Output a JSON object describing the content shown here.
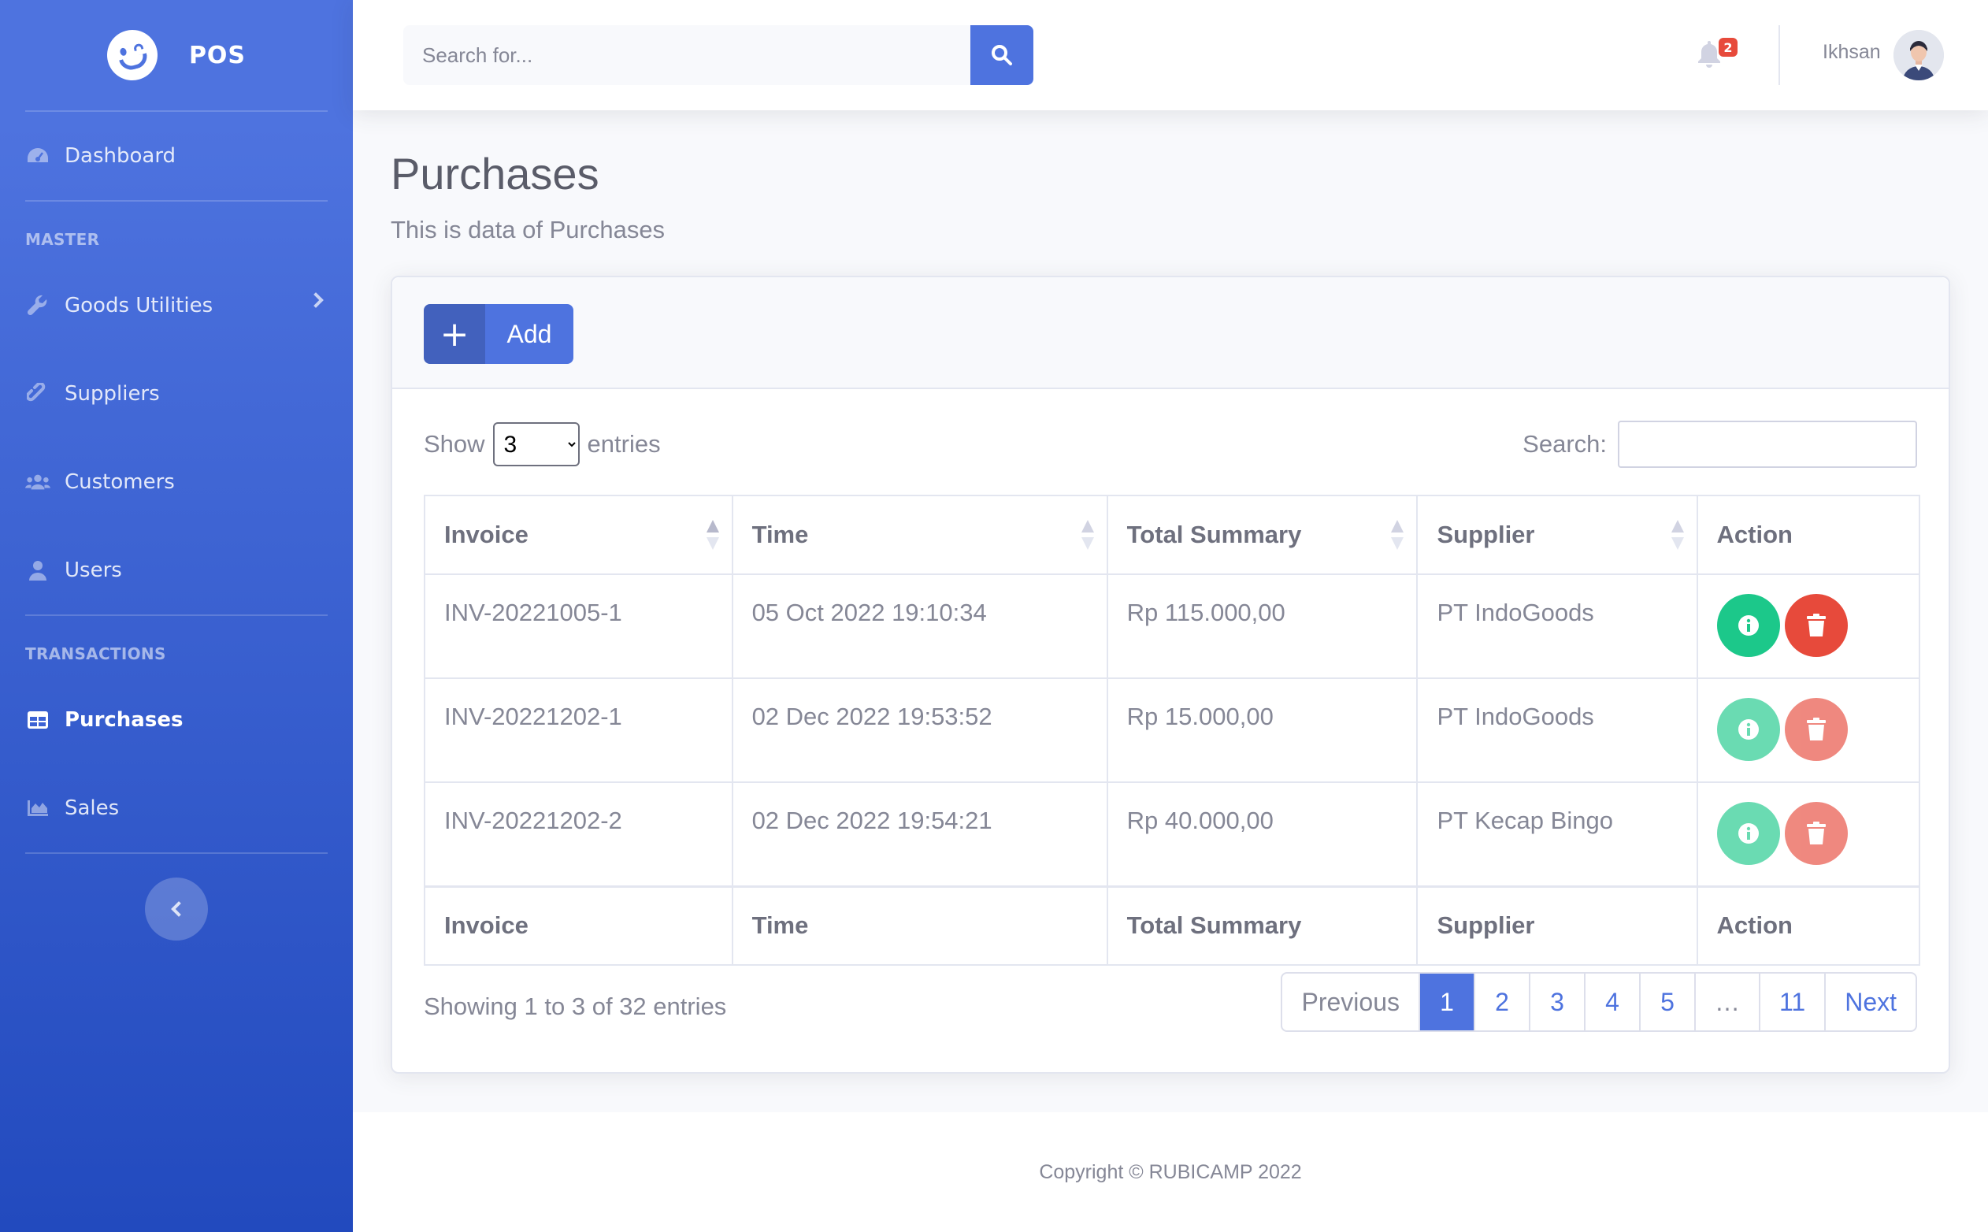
{
  "brand": {
    "name": "POS"
  },
  "sidebar": {
    "dashboard": "Dashboard",
    "heading_master": "MASTER",
    "goods_utilities": "Goods Utilities",
    "suppliers": "Suppliers",
    "customers": "Customers",
    "users": "Users",
    "heading_transactions": "TRANSACTIONS",
    "purchases": "Purchases",
    "sales": "Sales"
  },
  "topbar": {
    "search_placeholder": "Search for...",
    "notification_count": "2",
    "username": "Ikhsan"
  },
  "page": {
    "title": "Purchases",
    "subtitle": "This is data of Purchases"
  },
  "card": {
    "add_label": "Add",
    "show_label": "Show",
    "entries_label": "entries",
    "page_length": "3",
    "search_label": "Search:"
  },
  "table": {
    "headers": [
      "Invoice",
      "Time",
      "Total Summary",
      "Supplier",
      "Action"
    ],
    "rows": [
      {
        "invoice": "INV-20221005-1",
        "time": "05 Oct 2022 19:10:34",
        "total": "Rp 115.000,00",
        "supplier": "PT IndoGoods"
      },
      {
        "invoice": "INV-20221202-1",
        "time": "02 Dec 2022 19:53:52",
        "total": "Rp 15.000,00",
        "supplier": "PT IndoGoods"
      },
      {
        "invoice": "INV-20221202-2",
        "time": "02 Dec 2022 19:54:21",
        "total": "Rp 40.000,00",
        "supplier": "PT Kecap Bingo"
      }
    ]
  },
  "pagination": {
    "info": "Showing 1 to 3 of 32 entries",
    "previous": "Previous",
    "pages": [
      "1",
      "2",
      "3",
      "4",
      "5",
      "…",
      "11"
    ],
    "next": "Next",
    "current": "1"
  },
  "footer": {
    "copyright": "Copyright © RUBICAMP 2022"
  },
  "colors": {
    "primary": "#4e73df",
    "success": "#1cc88a",
    "danger": "#e74a3b"
  }
}
